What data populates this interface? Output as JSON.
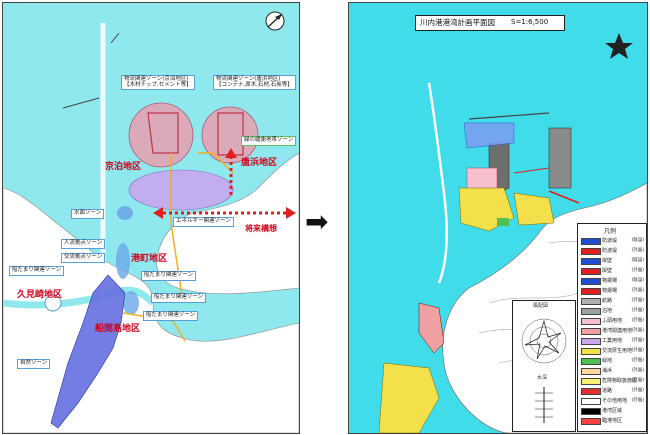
{
  "left_map": {
    "labels": {
      "kyodomari": "京泊地区",
      "karahama": "唐浜地区",
      "minatomachi": "港町地区",
      "kumizaki": "久見崎地区",
      "funamajima": "船間島地区",
      "future_plan": "将来構想"
    },
    "zones": {
      "logistics_west": "物流関連ゾーン(京泊地区)",
      "logistics_west_sub": "【木材チップ,セメント等】",
      "logistics_east": "物流関連ゾーン(唐浜地区)",
      "logistics_east_sub": "【コンテナ,原木,石材,石炭等】",
      "green_space": "緑の緩衝地帯ゾーン",
      "energy": "エネルギー関連ゾーン",
      "water_sports": "水面ゾーン",
      "recreation": "人流拠点ゾーン",
      "exchange": "交流拠点ゾーン",
      "marina": "船だまり関連ゾーン",
      "marina_center": "船だまり関連ゾーン",
      "fishery": "船だまり関連ゾーン",
      "boat_north": "船だまり関連ゾーン",
      "seashore": "自然ゾーン",
      "energy_line": "エネルギー関連ゾーン"
    }
  },
  "arrow": {
    "symbol": "➡"
  },
  "right_map": {
    "title": "川内港港湾計画平面図",
    "scale": "S=1:6,500",
    "legend_title": "凡例",
    "legend": [
      {
        "name": "防波堤",
        "status": "(既設)",
        "color": "#1f4fd0"
      },
      {
        "name": "防波堤",
        "status": "(計画)",
        "color": "#e02020"
      },
      {
        "name": "岸壁",
        "status": "(既設)",
        "color": "#1f4fd0"
      },
      {
        "name": "岸壁",
        "status": "(計画)",
        "color": "#e02020"
      },
      {
        "name": "物揚場",
        "status": "(既設)",
        "color": "#1f4fd0"
      },
      {
        "name": "物揚場",
        "status": "(計画)",
        "color": "#e02020"
      },
      {
        "name": "航路",
        "status": "(計画)",
        "color": "#b0b0b0"
      },
      {
        "name": "泊地",
        "status": "(計画)",
        "color": "#9aa0a8"
      },
      {
        "name": "ふ頭用地",
        "status": "(計画)",
        "color": "#f6c0cf"
      },
      {
        "name": "港湾関連用地",
        "status": "(計画)",
        "color": "#f0a0a0"
      },
      {
        "name": "工業用地",
        "status": "(計画)",
        "color": "#c8a8e8"
      },
      {
        "name": "交流厚生用地",
        "status": "(計画)",
        "color": "#f4e04a"
      },
      {
        "name": "緑地",
        "status": "(計画)",
        "color": "#50c050"
      },
      {
        "name": "海浜",
        "status": "(計画)",
        "color": "#ffd8a0"
      },
      {
        "name": "危険物取扱施設",
        "status": "(計画)",
        "color": "#f8f070"
      },
      {
        "name": "道路",
        "status": "(計画)",
        "color": "#e03030"
      },
      {
        "name": "その他用地",
        "status": "(計画)",
        "color": "#ffffff"
      },
      {
        "name": "港湾区域",
        "status": "",
        "color": "#000000"
      },
      {
        "name": "臨港地区",
        "status": "",
        "color": "#ff4040"
      }
    ],
    "windrose_title": "風配図",
    "depth_title": "水深"
  },
  "colors": {
    "sea": "#8fe8ee",
    "sea_right": "#40dcea",
    "land": "#ffffff",
    "pink": "#e8a0b0",
    "purple": "#c8a8ee",
    "blue_zone": "#6aa8e8",
    "dark_blue": "#6470e0",
    "red": "#d0021b",
    "orange": "#f0b020"
  }
}
